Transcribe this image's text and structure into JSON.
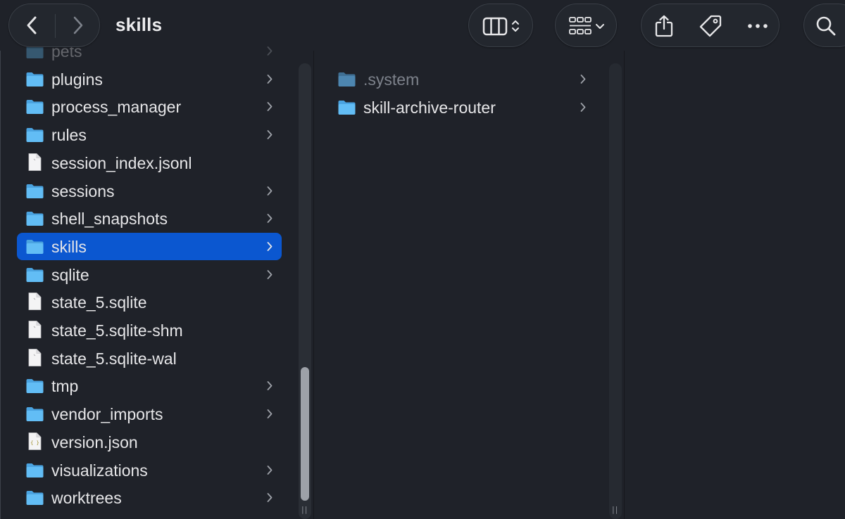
{
  "window": {
    "title": "skills"
  },
  "toolbar": {
    "back_icon": "chevron-left-icon",
    "forward_icon": "chevron-right-icon",
    "view_icon": "columns-view-icon",
    "group_icon": "grid-group-icon",
    "share_icon": "share-icon",
    "tag_icon": "tag-icon",
    "more_icon": "ellipsis-icon",
    "search_icon": "search-icon"
  },
  "column1": {
    "items": [
      {
        "name": "pets",
        "kind": "folder",
        "has_children": true
      },
      {
        "name": "plugins",
        "kind": "folder",
        "has_children": true
      },
      {
        "name": "process_manager",
        "kind": "folder",
        "has_children": true
      },
      {
        "name": "rules",
        "kind": "folder",
        "has_children": true
      },
      {
        "name": "session_index.jsonl",
        "kind": "file",
        "has_children": false
      },
      {
        "name": "sessions",
        "kind": "folder",
        "has_children": true
      },
      {
        "name": "shell_snapshots",
        "kind": "folder",
        "has_children": true
      },
      {
        "name": "skills",
        "kind": "folder",
        "has_children": true,
        "selected": true
      },
      {
        "name": "sqlite",
        "kind": "folder",
        "has_children": true
      },
      {
        "name": "state_5.sqlite",
        "kind": "file",
        "has_children": false
      },
      {
        "name": "state_5.sqlite-shm",
        "kind": "file",
        "has_children": false
      },
      {
        "name": "state_5.sqlite-wal",
        "kind": "file",
        "has_children": false
      },
      {
        "name": "tmp",
        "kind": "folder",
        "has_children": true
      },
      {
        "name": "vendor_imports",
        "kind": "folder",
        "has_children": true
      },
      {
        "name": "version.json",
        "kind": "json",
        "has_children": false
      },
      {
        "name": "visualizations",
        "kind": "folder",
        "has_children": true
      },
      {
        "name": "worktrees",
        "kind": "folder",
        "has_children": true
      }
    ]
  },
  "column2": {
    "items": [
      {
        "name": ".system",
        "kind": "folder",
        "has_children": true,
        "hidden": true
      },
      {
        "name": "skill-archive-router",
        "kind": "folder",
        "has_children": true
      }
    ]
  },
  "colors": {
    "background": "#1f2229",
    "selection": "#0b57d0",
    "folder": "#5ab3ee",
    "text": "#e6e6e8",
    "hidden_text": "#7d828b"
  }
}
